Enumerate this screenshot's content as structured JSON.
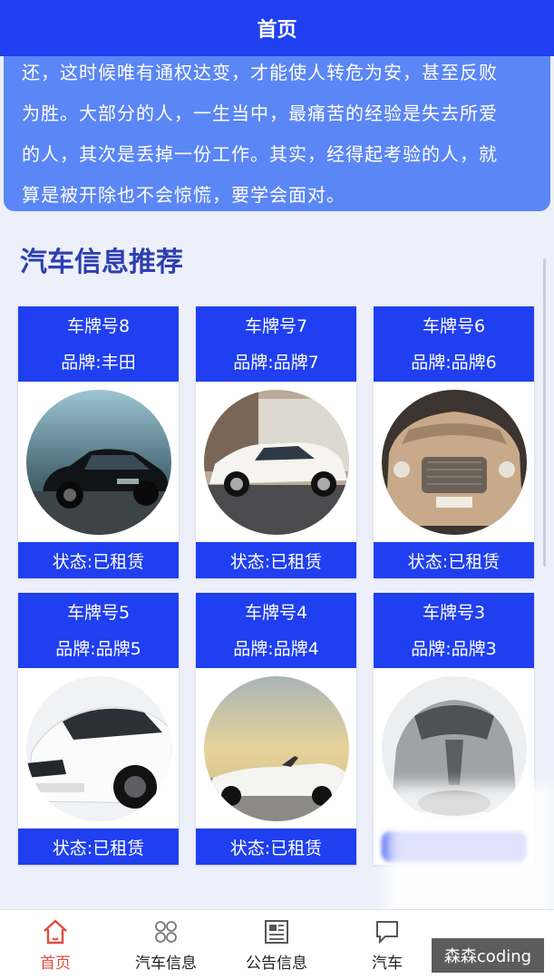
{
  "header": {
    "title": "首页"
  },
  "intro": {
    "lines": [
      "还，这时候唯有通权达变，才能使人转危为安，甚至反败",
      "为胜。大部分的人，一生当中，最痛苦的经验是失去所爱",
      "的人，其次是丢掉一份工作。其实，经得起考验的人，就",
      "算是被开除也不会惊慌，要学会面对。"
    ]
  },
  "section": {
    "title": "汽车信息推荐"
  },
  "cars": [
    {
      "plate": "车牌号8",
      "brand": "品牌:丰田",
      "status": "状态:已租赁",
      "image": "black-sedan"
    },
    {
      "plate": "车牌号7",
      "brand": "品牌:品牌7",
      "status": "状态:已租赁",
      "image": "white-suv"
    },
    {
      "plate": "车牌号6",
      "brand": "品牌:品牌6",
      "status": "状态:已租赁",
      "image": "gold-luxury-front"
    },
    {
      "plate": "车牌号5",
      "brand": "品牌:品牌5",
      "status": "状态:已租赁",
      "image": "white-crossover"
    },
    {
      "plate": "车牌号4",
      "brand": "品牌:品牌4",
      "status": "状态:已租赁",
      "image": "white-convertible"
    },
    {
      "plate": "车牌号3",
      "brand": "品牌:品牌3",
      "status": "",
      "image": "silver-concept"
    }
  ],
  "tabs": [
    {
      "label": "首页",
      "icon": "home-icon",
      "active": true
    },
    {
      "label": "汽车信息",
      "icon": "grid-icon",
      "active": false
    },
    {
      "label": "公告信息",
      "icon": "newspaper-icon",
      "active": false
    },
    {
      "label": "汽车",
      "icon": "chat-icon",
      "active": false
    }
  ],
  "watermark": "森森coding",
  "colors": {
    "primary": "#1f3ff0",
    "intro_bg": "#5b86f5",
    "active_tab": "#e04a3a",
    "title": "#2e3fb0"
  }
}
